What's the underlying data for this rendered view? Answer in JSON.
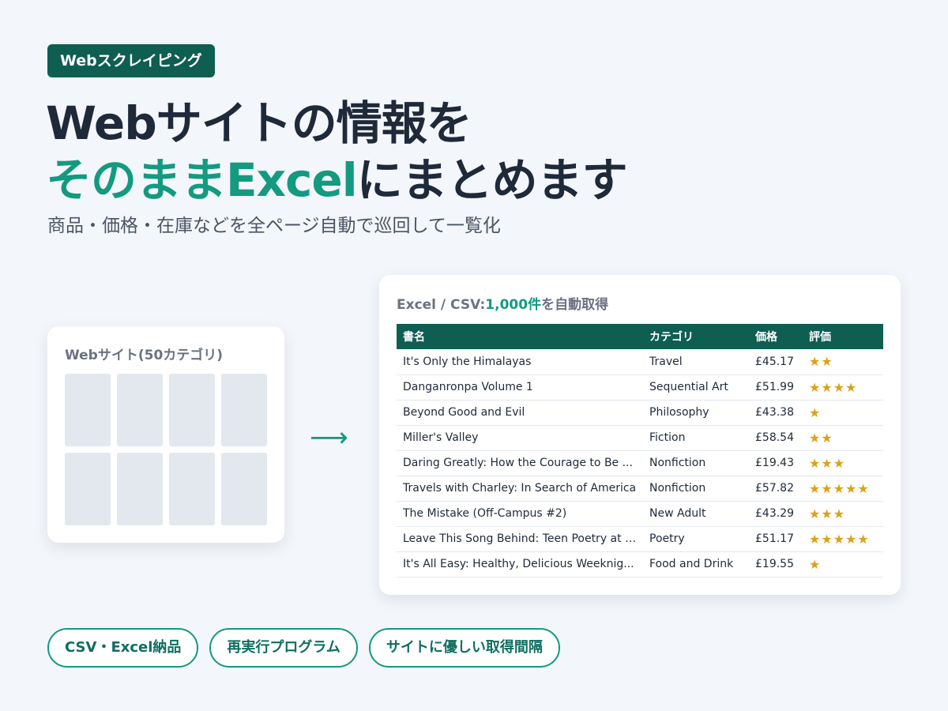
{
  "badge": "Webスクレイピング",
  "headline": {
    "line1": "Webサイトの情報を",
    "line2_accent": "そのままExcel",
    "line2_rest": "にまとめます"
  },
  "subtitle": "商品・価格・在庫などを全ページ自動で巡回して一覧化",
  "site_card": {
    "title": "Webサイト(50カテゴリ)",
    "tile_count": 8
  },
  "arrow": "⟶",
  "table_card": {
    "title_prefix": "Excel / CSV:",
    "title_count": "1,000件",
    "title_suffix": "を自動取得",
    "columns": [
      "書名",
      "カテゴリ",
      "価格",
      "評価"
    ],
    "rows": [
      {
        "title": "It's Only the Himalayas",
        "category": "Travel",
        "price": "£45.17",
        "rating": 2
      },
      {
        "title": "Danganronpa Volume 1",
        "category": "Sequential Art",
        "price": "£51.99",
        "rating": 4
      },
      {
        "title": "Beyond Good and Evil",
        "category": "Philosophy",
        "price": "£43.38",
        "rating": 1
      },
      {
        "title": "Miller's Valley",
        "category": "Fiction",
        "price": "£58.54",
        "rating": 2
      },
      {
        "title": "Daring Greatly: How the Courage to Be ...",
        "category": "Nonfiction",
        "price": "£19.43",
        "rating": 3
      },
      {
        "title": "Travels with Charley: In Search of America",
        "category": "Nonfiction",
        "price": "£57.82",
        "rating": 5
      },
      {
        "title": "The Mistake (Off-Campus #2)",
        "category": "New Adult",
        "price": "£43.29",
        "rating": 3
      },
      {
        "title": "Leave This Song Behind: Teen Poetry at I...",
        "category": "Poetry",
        "price": "£51.17",
        "rating": 5
      },
      {
        "title": "It's All Easy: Healthy, Delicious Weeknig...",
        "category": "Food and Drink",
        "price": "£19.55",
        "rating": 1
      }
    ]
  },
  "pills": [
    "CSV・Excel納品",
    "再実行プログラム",
    "サイトに優しい取得間隔"
  ],
  "colors": {
    "brand_dark": "#0e5e52",
    "accent": "#139a80",
    "star": "#d9a21b",
    "background": "#f3f6fa"
  },
  "icons": {
    "arrow": "arrow-right-icon",
    "star": "star-icon"
  }
}
